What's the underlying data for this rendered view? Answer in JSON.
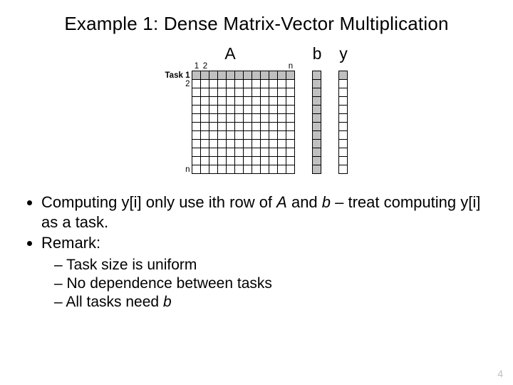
{
  "title": "Example 1: Dense Matrix-Vector Multiplication",
  "figure": {
    "A_label": "A",
    "b_label": "b",
    "y_label": "y",
    "col1": "1",
    "col2": "2",
    "coln": "n",
    "row1": "Task 1",
    "row2": "2",
    "rown": "n",
    "n_cells": 12
  },
  "bullets": {
    "b1_pre": "Computing y[i] only use ith row of ",
    "b1_A": "A",
    "b1_mid": " and ",
    "b1_b": "b",
    "b1_post": " – treat computing y[i] as a task.",
    "b2": "Remark:",
    "sub1": "Task size is uniform",
    "sub2": "No dependence between tasks",
    "sub3": "All tasks need ",
    "sub3_b": "b"
  },
  "page": "4"
}
